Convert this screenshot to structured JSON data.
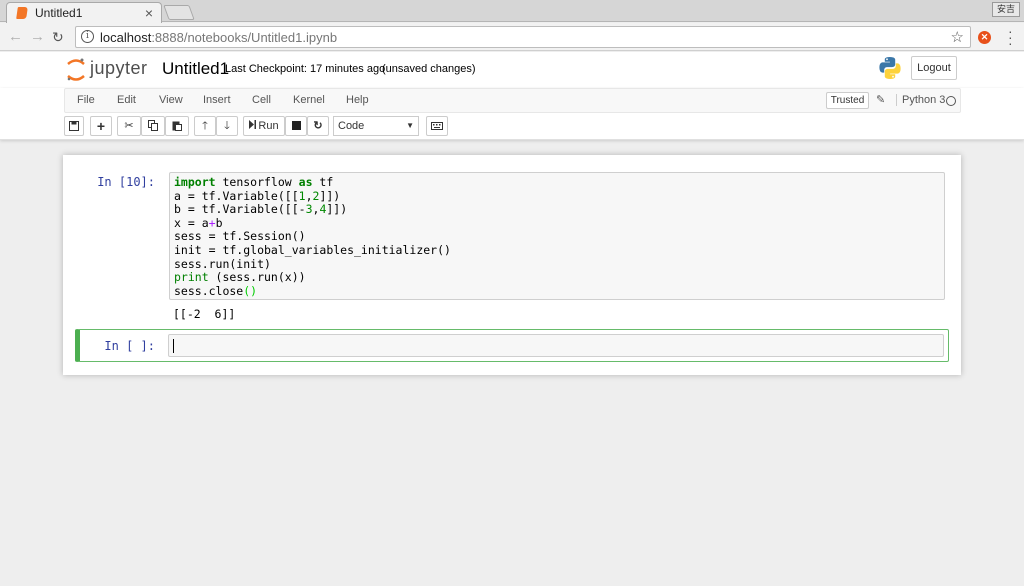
{
  "browser": {
    "tab_title": "Untitled1",
    "tab_close": "×",
    "window_label": "安吉",
    "url_host": "localhost",
    "url_rest": ":8888/notebooks/Untitled1.ipynb"
  },
  "header": {
    "logo_text": "jupyter",
    "notebook_name": "Untitled1",
    "checkpoint": "Last Checkpoint: 17 minutes ago",
    "unsaved": "(unsaved changes)",
    "logout_label": "Logout"
  },
  "menubar": {
    "items": [
      "File",
      "Edit",
      "View",
      "Insert",
      "Cell",
      "Kernel",
      "Help"
    ],
    "trusted_label": "Trusted",
    "kernel_name": "Python 3"
  },
  "toolbar": {
    "run_label": "Run",
    "cell_type": "Code"
  },
  "cells": [
    {
      "prompt": "In [10]:",
      "output": "[[-2  6]]"
    },
    {
      "prompt": "In [ ]:"
    }
  ],
  "colors": {
    "accent_orange": "#f37626",
    "prompt_blue": "#303f9f",
    "keyword_green": "#008000",
    "selected_cell_green": "#4caf50"
  }
}
